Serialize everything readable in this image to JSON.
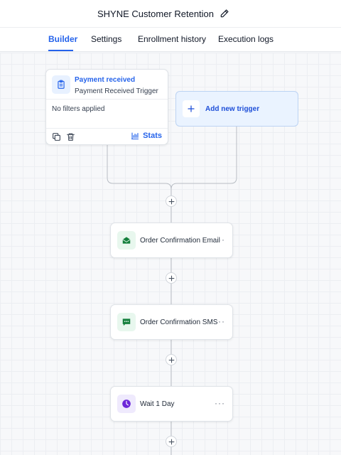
{
  "header": {
    "title": "SHYNE Customer Retention",
    "tabs": [
      {
        "label": "Builder"
      },
      {
        "label": "Settings"
      },
      {
        "label": "Enrollment history"
      },
      {
        "label": "Execution logs"
      }
    ]
  },
  "trigger": {
    "title": "Payment received",
    "subtitle": "Payment Received Trigger",
    "filters": "No filters applied",
    "stats_label": "Stats"
  },
  "add_trigger": {
    "label": "Add new trigger"
  },
  "steps": [
    {
      "label": "Order Confirmation Email",
      "icon": "email-icon"
    },
    {
      "label": "Order Confirmation SMS",
      "icon": "sms-icon"
    },
    {
      "label": "Wait 1 Day",
      "icon": "clock-icon"
    }
  ],
  "colors": {
    "accent": "#2563eb",
    "email_icon": "#15803d",
    "wait_icon": "#6d28d9"
  }
}
